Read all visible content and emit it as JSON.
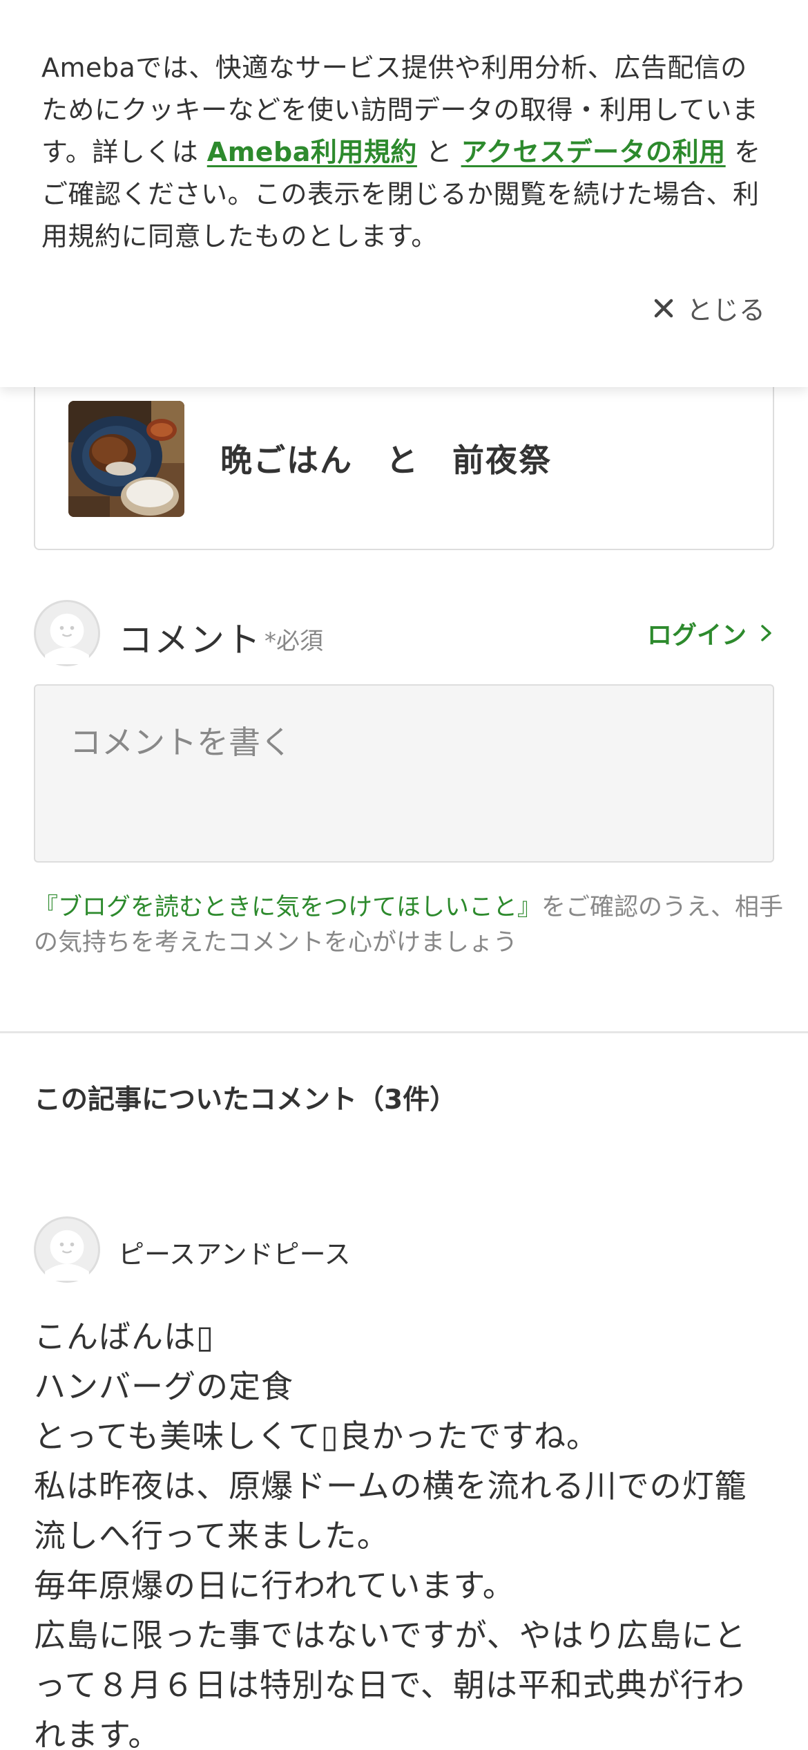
{
  "cookie_banner": {
    "text_1": "Amebaでは、快適なサービス提供や利用分析、広告配信のためにクッキーなどを使い訪問データの取得・利用しています。詳しくは ",
    "link_terms": "Ameba利用規約",
    "text_2": " と ",
    "link_access_data": "アクセスデータの利用",
    "text_3": " をご確認ください。この表示を閉じるか閲覧を続けた場合、利用規約に同意したものとします。",
    "close_label": "とじる",
    "close_icon": "close-icon"
  },
  "article": {
    "title": "晩ごはん　と　前夜祭",
    "thumbnail_icon": "food-photo"
  },
  "comment_form": {
    "label": "コメント",
    "required": "*必須",
    "login_label": "ログイン",
    "placeholder": "コメントを書く",
    "guide_link": "『ブログを読むときに気をつけてほしいこと』",
    "guide_text": "をご確認のうえ、相手の気持ちを考えたコメントを心がけましょう"
  },
  "comments_section": {
    "heading": "この記事についたコメント（3件）",
    "comments": [
      {
        "author": "ピースアンドピース",
        "lines": [
          "こんばんは▯",
          "ハンバーグの定食",
          "とっても美味しくて▯良かったですね。",
          "私は昨夜は、原爆ドームの横を流れる川での灯籠",
          "流しへ行って来ました。",
          "毎年原爆の日に行われています。",
          "広島に限った事ではないですが、やはり広島にと",
          "って８月６日は特別な日で、朝は平和式典が行わ",
          "れます。"
        ]
      }
    ]
  },
  "colors": {
    "accent_green": "#2d8a2d",
    "text": "#333333",
    "muted": "#888888",
    "border": "#dddddd"
  }
}
